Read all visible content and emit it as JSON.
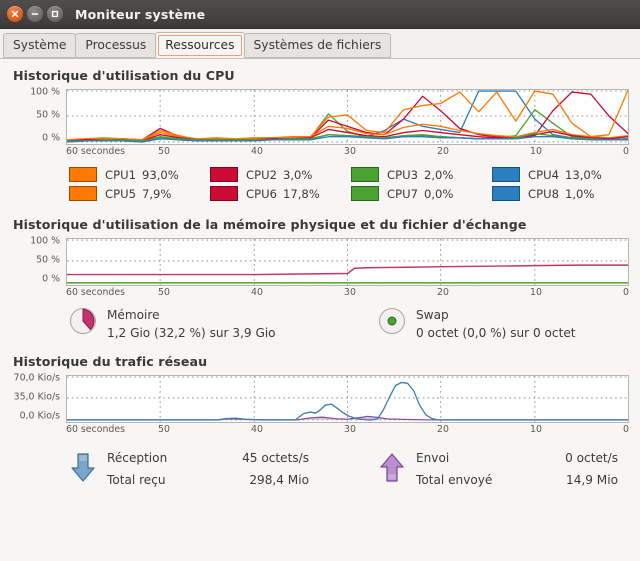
{
  "window": {
    "title": "Moniteur système",
    "buttons": {
      "close": "close-icon",
      "minimize": "minimize-icon",
      "maximize": "maximize-icon"
    }
  },
  "tabs": [
    {
      "label": "Système",
      "active": false
    },
    {
      "label": "Processus",
      "active": false
    },
    {
      "label": "Ressources",
      "active": true
    },
    {
      "label": "Systèmes de fichiers",
      "active": false
    }
  ],
  "cpu": {
    "title": "Historique d'utilisation du CPU",
    "y_ticks": [
      "100 %",
      "50 %",
      "0 %"
    ],
    "x_ticks": [
      "60 secondes",
      "50",
      "40",
      "30",
      "20",
      "10",
      "0"
    ],
    "legend": [
      {
        "name": "CPU1",
        "value": "93,0%",
        "color": "#ff7800"
      },
      {
        "name": "CPU2",
        "value": "3,0%",
        "color": "#cd0a35"
      },
      {
        "name": "CPU3",
        "value": "2,0%",
        "color": "#4aa331"
      },
      {
        "name": "CPU4",
        "value": "13,0%",
        "color": "#2b7ebf"
      },
      {
        "name": "CPU5",
        "value": "7,9%",
        "color": "#ff7800"
      },
      {
        "name": "CPU6",
        "value": "17,8%",
        "color": "#cd0a35"
      },
      {
        "name": "CPU7",
        "value": "0,0%",
        "color": "#4aa331"
      },
      {
        "name": "CPU8",
        "value": "1,0%",
        "color": "#2b7ebf"
      }
    ]
  },
  "memory": {
    "title": "Historique d'utilisation de la mémoire physique et du fichier d'échange",
    "y_ticks": [
      "100 %",
      "50 %",
      "0 %"
    ],
    "x_ticks": [
      "60 secondes",
      "50",
      "40",
      "30",
      "20",
      "10",
      "0"
    ],
    "mem": {
      "label": "Mémoire",
      "detail": "1,2 Gio (32,2 %) sur 3,9 Gio",
      "icon": "pie-chart-icon",
      "color": "#c4326a",
      "percent": 32.2
    },
    "swap": {
      "label": "Swap",
      "detail": "0 octet (0,0 %) sur 0 octet",
      "icon": "pie-chart-icon",
      "color": "#4aa331",
      "percent": 0
    }
  },
  "network": {
    "title": "Historique du trafic réseau",
    "y_ticks": [
      "70,0 Kio/s",
      "35,0 Kio/s",
      "0,0 Kio/s"
    ],
    "x_ticks": [
      "60 secondes",
      "50",
      "40",
      "30",
      "20",
      "10",
      "0"
    ],
    "receive": {
      "label": "Réception",
      "rate": "45 octets/s",
      "total_label": "Total reçu",
      "total": "298,4 Mio",
      "icon": "arrow-down-icon",
      "color": "#4f86b8"
    },
    "send": {
      "label": "Envoi",
      "rate": "0 octet/s",
      "total_label": "Total envoyé",
      "total": "14,9 Mio",
      "icon": "arrow-up-icon",
      "color": "#8f4fa8"
    }
  },
  "chart_data": [
    {
      "type": "line",
      "title": "Historique d'utilisation du CPU",
      "xlabel": "secondes",
      "ylabel": "%",
      "ylim": [
        0,
        100
      ],
      "xlim": [
        60,
        0
      ],
      "grid": true,
      "legend_position": "below",
      "x": [
        60,
        58,
        56,
        54,
        52,
        50,
        48,
        46,
        44,
        42,
        40,
        38,
        36,
        34,
        32,
        30,
        28,
        26,
        24,
        22,
        20,
        18,
        16,
        14,
        12,
        10,
        8,
        6,
        4,
        2,
        0
      ],
      "series": [
        {
          "name": "CPU1",
          "color": "#ff7800",
          "values": [
            4,
            5,
            6,
            5,
            4,
            22,
            12,
            5,
            6,
            5,
            6,
            7,
            8,
            9,
            48,
            52,
            22,
            18,
            62,
            68,
            72,
            95,
            58,
            95,
            40,
            96,
            92,
            36,
            10,
            14,
            100
          ]
        },
        {
          "name": "CPU2",
          "color": "#cd0a35",
          "values": [
            3,
            4,
            5,
            6,
            5,
            26,
            10,
            4,
            5,
            4,
            5,
            6,
            7,
            8,
            42,
            30,
            18,
            14,
            44,
            88,
            60,
            26,
            14,
            10,
            8,
            12,
            60,
            96,
            92,
            46,
            16
          ]
        },
        {
          "name": "CPU3",
          "color": "#4aa331",
          "values": [
            2,
            3,
            4,
            3,
            2,
            10,
            6,
            3,
            4,
            3,
            4,
            5,
            6,
            7,
            52,
            20,
            10,
            8,
            12,
            14,
            10,
            8,
            6,
            8,
            12,
            62,
            34,
            10,
            6,
            4,
            6
          ]
        },
        {
          "name": "CPU4",
          "color": "#2b7ebf",
          "values": [
            1,
            2,
            3,
            2,
            1,
            8,
            4,
            2,
            3,
            2,
            3,
            4,
            5,
            6,
            14,
            12,
            10,
            22,
            44,
            30,
            24,
            18,
            100,
            100,
            100,
            44,
            14,
            8,
            5,
            3,
            4
          ]
        },
        {
          "name": "CPU5",
          "color": "#ff7800",
          "values": [
            5,
            6,
            7,
            6,
            5,
            18,
            10,
            6,
            7,
            6,
            7,
            8,
            9,
            10,
            30,
            26,
            16,
            14,
            28,
            34,
            30,
            22,
            16,
            12,
            10,
            18,
            24,
            14,
            10,
            8,
            12
          ]
        },
        {
          "name": "CPU6",
          "color": "#cd0a35",
          "values": [
            3,
            4,
            5,
            4,
            3,
            14,
            8,
            4,
            5,
            4,
            5,
            6,
            7,
            8,
            24,
            18,
            12,
            10,
            18,
            22,
            18,
            14,
            10,
            8,
            7,
            14,
            20,
            12,
            8,
            6,
            10
          ]
        },
        {
          "name": "CPU7",
          "color": "#4aa331",
          "values": [
            2,
            2,
            3,
            3,
            2,
            8,
            5,
            3,
            3,
            3,
            4,
            4,
            5,
            5,
            14,
            12,
            9,
            8,
            10,
            12,
            10,
            8,
            6,
            6,
            8,
            16,
            12,
            8,
            5,
            4,
            6
          ]
        },
        {
          "name": "CPU8",
          "color": "#2b7ebf",
          "values": [
            1,
            2,
            2,
            2,
            1,
            6,
            4,
            2,
            2,
            2,
            3,
            3,
            4,
            4,
            10,
            9,
            7,
            6,
            9,
            10,
            8,
            7,
            5,
            5,
            6,
            10,
            9,
            6,
            4,
            3,
            5
          ]
        }
      ]
    },
    {
      "type": "line",
      "title": "Historique d'utilisation de la mémoire physique et du fichier d'échange",
      "xlabel": "secondes",
      "ylabel": "%",
      "ylim": [
        0,
        100
      ],
      "xlim": [
        60,
        0
      ],
      "grid": true,
      "x": [
        60,
        55,
        50,
        45,
        40,
        35,
        30,
        29,
        25,
        20,
        15,
        10,
        5,
        0
      ],
      "series": [
        {
          "name": "Mémoire",
          "color": "#c4326a",
          "values": [
            19,
            19,
            19,
            19,
            19,
            20,
            20,
            27,
            29,
            30,
            31,
            32,
            32,
            32.2
          ]
        },
        {
          "name": "Swap",
          "color": "#4aa331",
          "values": [
            0,
            0,
            0,
            0,
            0,
            0,
            0,
            0,
            0,
            0,
            0,
            0,
            0,
            0
          ]
        }
      ]
    },
    {
      "type": "line",
      "title": "Historique du trafic réseau",
      "xlabel": "secondes",
      "ylabel": "Kio/s",
      "ylim": [
        0,
        70
      ],
      "xlim": [
        60,
        0
      ],
      "grid": true,
      "x": [
        60,
        56,
        52,
        48,
        44,
        42,
        40,
        38,
        36,
        35,
        34,
        33,
        32,
        31,
        30,
        29,
        28,
        27,
        26,
        25,
        24,
        22,
        20,
        16,
        12,
        8,
        4,
        0
      ],
      "series": [
        {
          "name": "Réception",
          "color": "#4f86b8",
          "values": [
            0,
            0,
            0,
            0,
            1.5,
            1,
            0,
            0,
            0,
            10,
            14,
            20,
            18,
            10,
            2,
            1,
            10,
            46,
            62,
            40,
            8,
            1,
            0,
            0,
            0,
            0,
            0,
            0
          ]
        },
        {
          "name": "Envoi",
          "color": "#8f4fa8",
          "values": [
            0,
            0,
            0,
            0,
            0.5,
            0.4,
            0,
            0,
            0,
            1.5,
            2,
            3,
            2.5,
            1.8,
            1.2,
            1,
            1.6,
            3.2,
            4,
            3,
            1.6,
            1,
            0.6,
            0.2,
            0,
            0,
            0,
            0
          ]
        }
      ]
    }
  ]
}
